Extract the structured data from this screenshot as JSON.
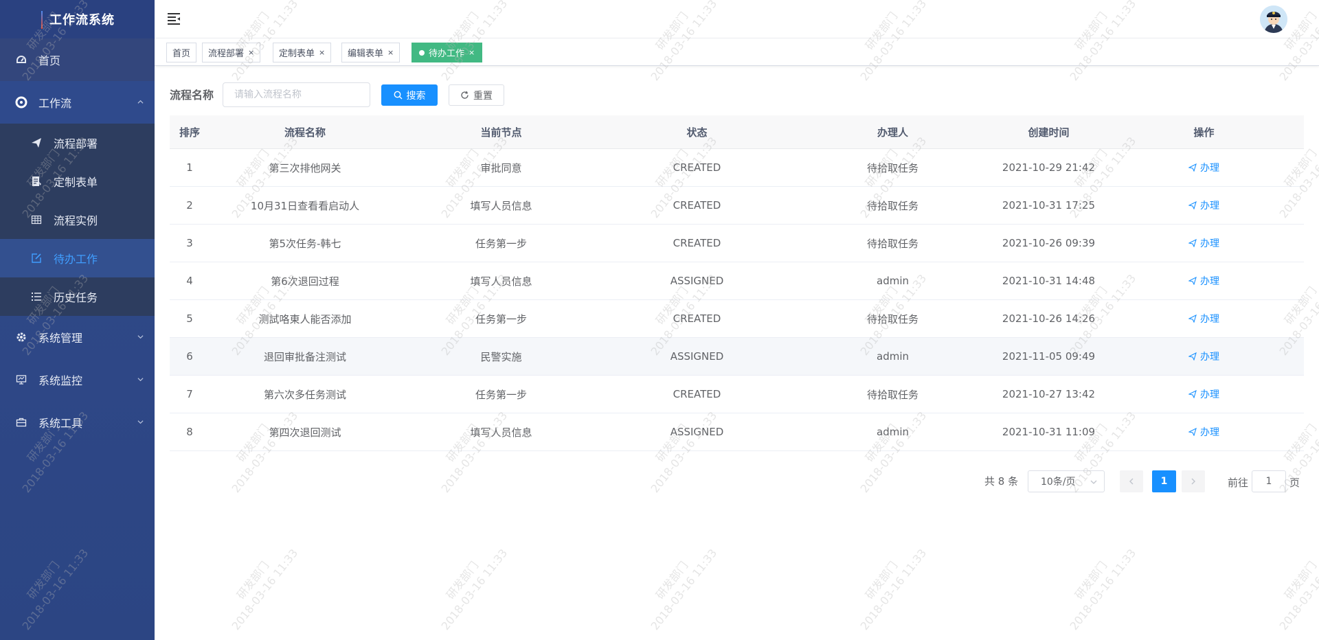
{
  "app": {
    "title": "工作流系统"
  },
  "sidebar": {
    "home": "首页",
    "workflow": "工作流",
    "sub": [
      "流程部署",
      "定制表单",
      "流程实例",
      "待办工作",
      "历史任务"
    ],
    "system_manage": "系统管理",
    "system_monitor": "系统监控",
    "system_tools": "系统工具"
  },
  "tags": [
    "首页",
    "流程部署",
    "定制表单",
    "编辑表单",
    "待办工作"
  ],
  "search": {
    "label": "流程名称",
    "placeholder": "请输入流程名称",
    "search_btn": "搜索",
    "reset_btn": "重置"
  },
  "table": {
    "headers": [
      "排序",
      "流程名称",
      "当前节点",
      "状态",
      "办理人",
      "创建时间",
      "操作"
    ],
    "action_label": "办理",
    "rows": [
      [
        "1",
        "第三次排他网关",
        "审批同意",
        "CREATED",
        "待拾取任务",
        "2021-10-29 21:42"
      ],
      [
        "2",
        "10月31日查看看启动人",
        "填写人员信息",
        "CREATED",
        "待拾取任务",
        "2021-10-31 17:25"
      ],
      [
        "3",
        "第5次任务-韩七",
        "任务第一步",
        "CREATED",
        "待拾取任务",
        "2021-10-26 09:39"
      ],
      [
        "4",
        "第6次退回过程",
        "填写人员信息",
        "ASSIGNED",
        "admin",
        "2021-10-31 14:48"
      ],
      [
        "5",
        "测試咯東人能否添加",
        "任务第一步",
        "CREATED",
        "待拾取任务",
        "2021-10-26 14:26"
      ],
      [
        "6",
        "退回审批备注测试",
        "民警实施",
        "ASSIGNED",
        "admin",
        "2021-11-05 09:49"
      ],
      [
        "7",
        "第六次多任务测试",
        "任务第一步",
        "CREATED",
        "待拾取任务",
        "2021-10-27 13:42"
      ],
      [
        "8",
        "第四次退回测试",
        "填写人员信息",
        "ASSIGNED",
        "admin",
        "2021-10-31 11:09"
      ]
    ]
  },
  "pager": {
    "total": "共 8 条",
    "size": "10条/页",
    "current": "1",
    "goto": "前往",
    "page_input": "1",
    "page_unit": "页"
  },
  "watermark": {
    "dept": "研发部门",
    "time": "2018-03-16 11:33"
  },
  "colors": {
    "sidebar": "#304a8a",
    "primary": "#1890ff",
    "tag_active": "#42b983"
  }
}
